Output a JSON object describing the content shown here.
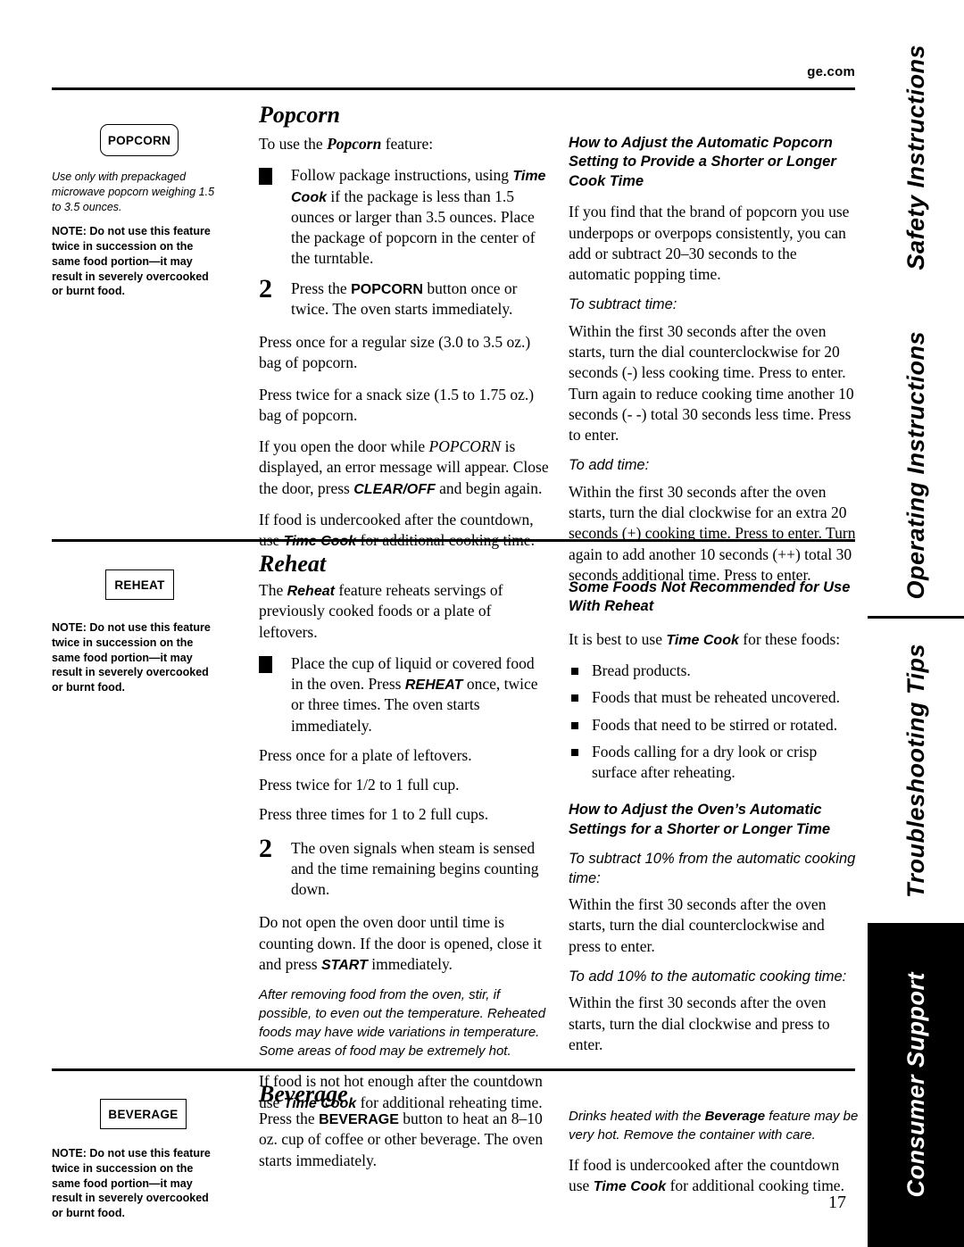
{
  "page": {
    "site": "ge.com",
    "number": "17"
  },
  "side_tabs": [
    {
      "label": "Safety Instructions",
      "style": "white"
    },
    {
      "label": "Operating Instructions",
      "style": "white"
    },
    {
      "label": "Troubleshooting Tips",
      "style": "white"
    },
    {
      "label": "Consumer Support",
      "style": "black"
    }
  ],
  "sections": {
    "popcorn": {
      "title": "Popcorn",
      "button_label": "POPCORN",
      "margin_note_1": "Use only with prepackaged microwave popcorn weighing 1.5 to 3.5 ounces.",
      "margin_note_2": "NOTE: Do not use this feature twice in succession on the same food portion—it may result in severely overcooked or burnt food.",
      "intro_pre": "To use the ",
      "intro_em": "Popcorn",
      "intro_post": " feature:",
      "step1_a": "Follow package instructions, using ",
      "step1_b": "Time Cook",
      "step1_c": " if the package is less than 1.5 ounces or larger than 3.5 ounces. Place the package of popcorn in the center of the turntable.",
      "step2_a": "Press the ",
      "step2_b": "POPCORN",
      "step2_c": " button once or twice. The oven starts immediately.",
      "p1": "Press once for a regular size (3.0 to 3.5 oz.) bag of popcorn.",
      "p2": "Press twice for a snack size (1.5 to 1.75 oz.) bag of popcorn.",
      "p3_a": "If you open the door while ",
      "p3_b": "POPCORN",
      "p3_c": " is displayed, an error message will appear. Close the door, press ",
      "p3_d": "CLEAR/OFF",
      "p3_e": " and begin again.",
      "p4_a": "If food is undercooked after the countdown, use ",
      "p4_b": "Time Cook",
      "p4_c": " for additional cooking time.",
      "right_head": "How to Adjust the Automatic Popcorn Setting to Provide a Shorter or Longer Cook Time",
      "right_p1": "If you find that the brand of popcorn you use underpops or overpops consistently, you can add or subtract 20–30 seconds to the automatic popping time.",
      "right_sub1": "To subtract time:",
      "right_p2": "Within the first 30 seconds after the oven starts, turn the dial counterclockwise for 20 seconds (-) less cooking time. Press to enter. Turn again to reduce cooking time another 10  seconds (- -) total 30 seconds less time. Press to enter.",
      "right_sub2": "To add time:",
      "right_p3": "Within the first 30 seconds after the oven starts, turn the dial clockwise for an extra 20 seconds (+) cooking time. Press to enter. Turn again to add another 10  seconds (++) total 30 seconds additional time. Press to enter."
    },
    "reheat": {
      "title": "Reheat",
      "button_label": "REHEAT",
      "margin_note": "NOTE: Do not use this feature twice in succession on the same food portion—it may result in severely overcooked or burnt food.",
      "intro_a": "The ",
      "intro_b": "Reheat",
      "intro_c": " feature reheats servings of previously cooked foods or a plate of leftovers.",
      "step1_a": "Place the cup of liquid or covered food in the oven. Press ",
      "step1_b": "REHEAT",
      "step1_c": " once, twice or three times. The oven starts immediately.",
      "p1": "Press once for a plate of leftovers.",
      "p2": "Press twice for 1/2 to 1 full cup.",
      "p3": "Press three times for 1 to 2 full cups.",
      "step2": "The oven signals when steam is sensed and the time remaining begins counting down.",
      "p4_a": "Do not open the oven door until time is counting down. If the door is opened, close it and press ",
      "p4_b": "START",
      "p4_c": " immediately.",
      "p5_italic": "After removing food from the oven, stir, if possible, to even out the temperature. Reheated foods may have wide variations in temperature. Some areas of food may be extremely hot.",
      "p6_a": "If food is not hot enough after the countdown use ",
      "p6_b": "Time Cook",
      "p6_c": " for additional reheating time.",
      "right_head": "Some Foods Not Recommended for Use With Reheat",
      "right_p1_a": "It is best to use ",
      "right_p1_b": "Time Cook",
      "right_p1_c": " for these foods:",
      "bullets": [
        "Bread products.",
        "Foods that must be reheated uncovered.",
        "Foods that need to be stirred or rotated.",
        "Foods calling for a dry look or crisp surface after reheating."
      ],
      "right_head2": "How to Adjust the Oven’s Automatic Settings for a Shorter or Longer Time",
      "right_sub1": "To subtract 10% from the automatic cooking time:",
      "right_p2": "Within the first 30 seconds after the oven starts, turn the dial counterclockwise and press to enter.",
      "right_sub2": "To add 10% to the automatic cooking time:",
      "right_p3": "Within the first 30 seconds after the oven starts, turn the dial clockwise and press to enter."
    },
    "beverage": {
      "title": "Beverage",
      "button_label": "BEVERAGE",
      "margin_note": "NOTE: Do not use this feature twice in succession on the same food portion—it may result in severely overcooked or burnt food.",
      "p1_a": "Press the ",
      "p1_b": "BEVERAGE",
      "p1_c": " button to heat an 8–10 oz. cup of coffee or other beverage. The oven starts immediately.",
      "right_p1_a": "Drinks heated with the ",
      "right_p1_b": "Beverage",
      "right_p1_c": " feature may be very hot. Remove the container with care.",
      "right_p2_a": "If food is undercooked after the countdown use ",
      "right_p2_b": "Time Cook",
      "right_p2_c": " for additional cooking time."
    }
  }
}
